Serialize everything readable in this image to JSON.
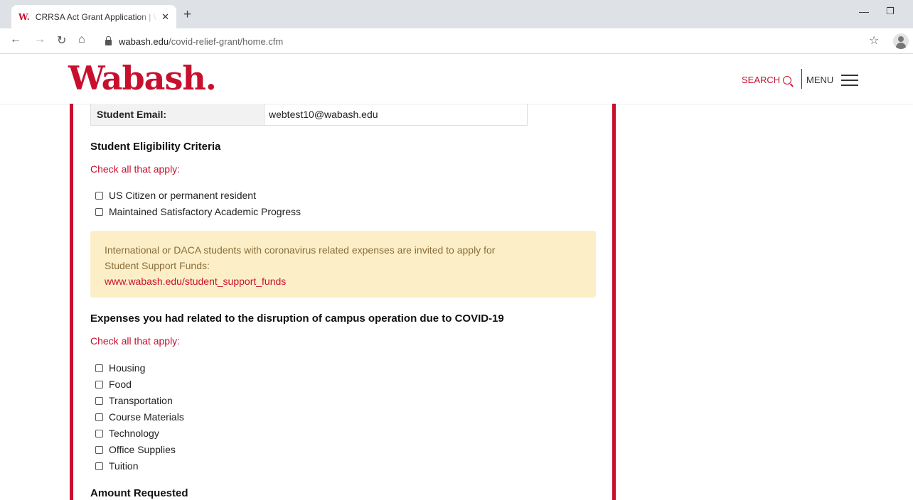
{
  "browser": {
    "tab_title": "CRRSA Act Grant Application | W",
    "tab_favicon": "W.",
    "url_host": "wabash.edu",
    "url_path": "/covid-relief-grant/home.cfm"
  },
  "header": {
    "logo": "Wabash.",
    "search_label": "SEARCH",
    "menu_label": "MENU"
  },
  "student_info": {
    "email_label": "Student Email:",
    "email_value": "webtest10@wabash.edu"
  },
  "eligibility": {
    "heading": "Student Eligibility Criteria",
    "hint": "Check all that apply:",
    "options": [
      "US Citizen or permanent resident",
      "Maintained Satisfactory Academic Progress"
    ]
  },
  "notice": {
    "line1": "International or DACA students with coronavirus related expenses are invited to apply for",
    "line2": "Student Support Funds:",
    "link": "www.wabash.edu/student_support_funds"
  },
  "expenses": {
    "heading": "Expenses you had related to the disruption of campus operation due to COVID-19",
    "hint": "Check all that apply:",
    "options": [
      "Housing",
      "Food",
      "Transportation",
      "Course Materials",
      "Technology",
      "Office Supplies",
      "Tuition"
    ]
  },
  "amount": {
    "heading": "Amount Requested"
  },
  "colors": {
    "brand_red": "#c8102e",
    "notice_bg": "#fcefc7"
  }
}
